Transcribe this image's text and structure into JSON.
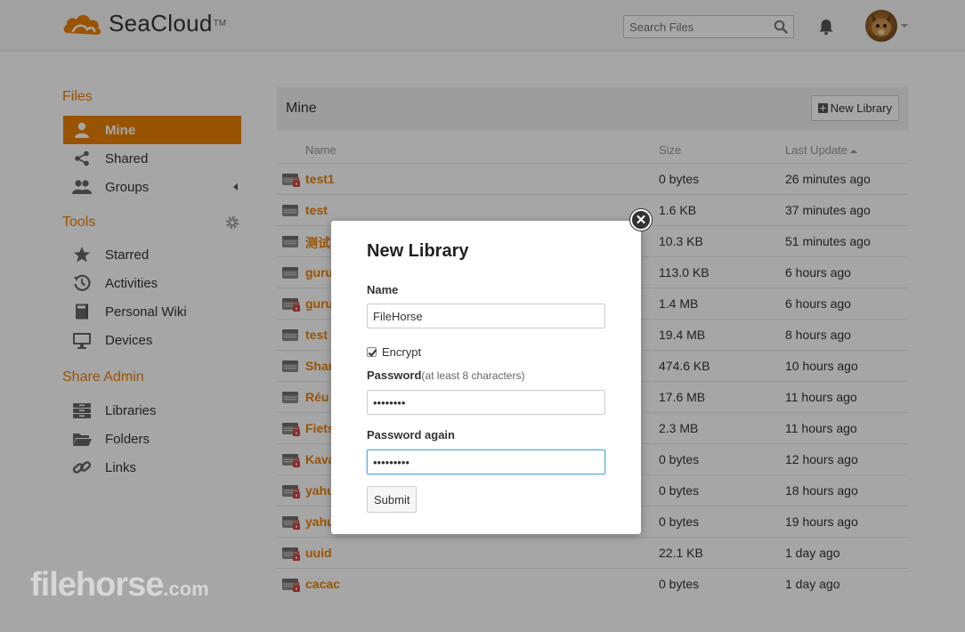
{
  "app": {
    "logo_text": "SeaCloud",
    "logo_tm": "TM",
    "search_placeholder": "Search Files",
    "brand_color": "#eb8205"
  },
  "sidebar": {
    "files_heading": "Files",
    "files_items": [
      {
        "label": "Mine",
        "icon": "user-icon",
        "active": true
      },
      {
        "label": "Shared",
        "icon": "share-icon"
      },
      {
        "label": "Groups",
        "icon": "group-icon"
      }
    ],
    "tools_heading": "Tools",
    "tools_items": [
      {
        "label": "Starred",
        "icon": "star-icon"
      },
      {
        "label": "Activities",
        "icon": "history-icon"
      },
      {
        "label": "Personal Wiki",
        "icon": "book-icon"
      },
      {
        "label": "Devices",
        "icon": "monitor-icon"
      }
    ],
    "admin_heading": "Share Admin",
    "admin_items": [
      {
        "label": "Libraries",
        "icon": "library-icon"
      },
      {
        "label": "Folders",
        "icon": "folder-icon"
      },
      {
        "label": "Links",
        "icon": "link-icon"
      }
    ]
  },
  "main": {
    "title": "Mine",
    "new_library_label": "New Library",
    "columns": {
      "name": "Name",
      "size": "Size",
      "updated": "Last Update"
    },
    "rows": [
      {
        "name": "test1",
        "size": "0 bytes",
        "updated": "26 minutes ago",
        "encrypted": true
      },
      {
        "name": "test",
        "size": "1.6 KB",
        "updated": "37 minutes ago",
        "encrypted": false
      },
      {
        "name": "测试",
        "size": "10.3 KB",
        "updated": "51 minutes ago",
        "encrypted": false
      },
      {
        "name": "guru",
        "size": "113.0 KB",
        "updated": "6 hours ago",
        "encrypted": false
      },
      {
        "name": "guru",
        "size": "1.4 MB",
        "updated": "6 hours ago",
        "encrypted": true
      },
      {
        "name": "test",
        "size": "19.4 MB",
        "updated": "8 hours ago",
        "encrypted": false
      },
      {
        "name": "Shar",
        "size": "474.6 KB",
        "updated": "10 hours ago",
        "encrypted": false
      },
      {
        "name": "Réu",
        "size": "17.6 MB",
        "updated": "11 hours ago",
        "encrypted": false
      },
      {
        "name": "Fiets",
        "size": "2.3 MB",
        "updated": "11 hours ago",
        "encrypted": true
      },
      {
        "name": "Kava",
        "size": "0 bytes",
        "updated": "12 hours ago",
        "encrypted": true
      },
      {
        "name": "yahu",
        "size": "0 bytes",
        "updated": "18 hours ago",
        "encrypted": true
      },
      {
        "name": "yahu",
        "size": "0 bytes",
        "updated": "19 hours ago",
        "encrypted": true
      },
      {
        "name": "uuid",
        "size": "22.1 KB",
        "updated": "1 day ago",
        "encrypted": true
      },
      {
        "name": "cacac",
        "size": "0 bytes",
        "updated": "1 day ago",
        "encrypted": true
      }
    ]
  },
  "dialog": {
    "title": "New Library",
    "name_label": "Name",
    "name_value": "FileHorse",
    "encrypt_label": "Encrypt",
    "encrypt_checked": true,
    "password_label": "Password",
    "password_hint": "(at least 8 characters)",
    "password_value": "••••••••",
    "password_again_label": "Password again",
    "password_again_value": "•••••••••",
    "submit_label": "Submit"
  },
  "watermark": {
    "text": "filehorse",
    "suffix": ".com"
  }
}
